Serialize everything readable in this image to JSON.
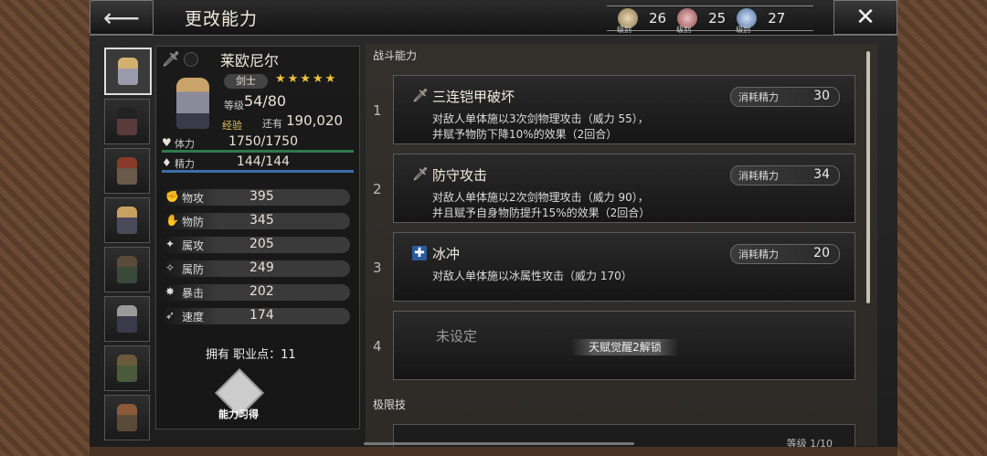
{
  "header": {
    "title": "更改能力",
    "back_icon": "back-arrow-icon",
    "close_icon": "close-icon"
  },
  "currencies": [
    {
      "label": "级别",
      "value": "26",
      "color": "#c8b48a"
    },
    {
      "label": "级别",
      "value": "25",
      "color": "#c87a7a"
    },
    {
      "label": "级别",
      "value": "27",
      "color": "#8aa8d8"
    }
  ],
  "character": {
    "name": "莱欧尼尔",
    "job": "剑士",
    "stars": "★★★★★",
    "level_label": "等级",
    "level": "54/80",
    "exp_label": "经验",
    "remaining_label": "还有",
    "remaining_exp": "190,020",
    "hp_label": "体力",
    "hp": "1750/1750",
    "sp_label": "精力",
    "sp": "144/144",
    "stats": [
      {
        "label": "物攻",
        "value": "395",
        "icon": "patk-icon"
      },
      {
        "label": "物防",
        "value": "345",
        "icon": "pdef-icon"
      },
      {
        "label": "属攻",
        "value": "205",
        "icon": "eatk-icon"
      },
      {
        "label": "属防",
        "value": "249",
        "icon": "edef-icon"
      },
      {
        "label": "暴击",
        "value": "202",
        "icon": "crit-icon"
      },
      {
        "label": "速度",
        "value": "174",
        "icon": "speed-icon"
      }
    ],
    "job_points": "拥有 职业点：11",
    "acquire_label": "能力习得"
  },
  "skills_section": "战斗能力",
  "skills": [
    {
      "num": "1",
      "name": "三连铠甲破坏",
      "cost_label": "消耗精力",
      "cost": "30",
      "desc1": "对敌人单体施以3次剑物理攻击（威力 55），",
      "desc2": "并赋予物防下降10%的效果（2回合）"
    },
    {
      "num": "2",
      "name": "防守攻击",
      "cost_label": "消耗精力",
      "cost": "34",
      "desc1": "对敌人单体施以2次剑物理攻击（威力 90），",
      "desc2": "并且赋予自身物防提升15%的效果（2回合）"
    },
    {
      "num": "3",
      "name": "冰冲",
      "cost_label": "消耗精力",
      "cost": "20",
      "desc1": "对敌人单体施以冰属性攻击（威力 170）",
      "desc2": ""
    }
  ],
  "slot4": {
    "num": "4",
    "unset": "未设定",
    "unlock": "天赋觉醒2解锁"
  },
  "limit_section": "极限技",
  "limit_peek_level": "等级 1/10"
}
